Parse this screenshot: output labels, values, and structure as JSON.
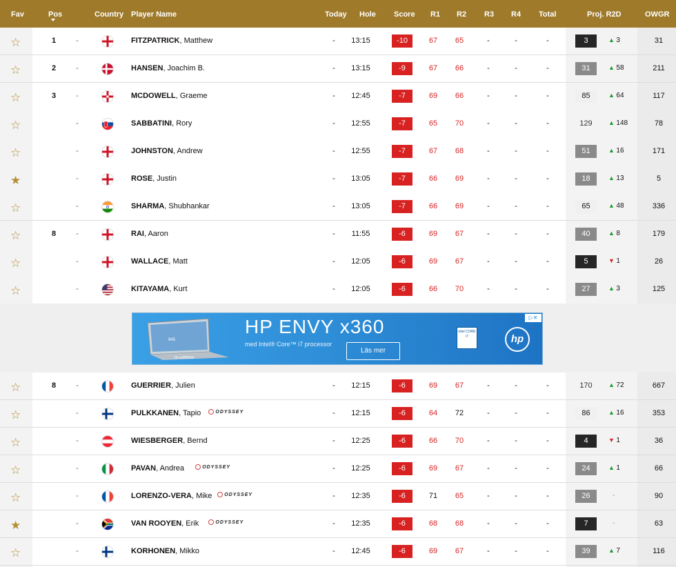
{
  "header": {
    "fav": "Fav",
    "pos": "Pos",
    "country": "Country",
    "player": "Player Name",
    "today": "Today",
    "hole": "Hole",
    "score": "Score",
    "r1": "R1",
    "r2": "R2",
    "r3": "R3",
    "r4": "R4",
    "total": "Total",
    "proj": "Proj. R2D",
    "owgr": "OWGR"
  },
  "colors": {
    "gold": "#9e7a2a",
    "score_red": "#d82222",
    "up_green": "#1a9a2e"
  },
  "rows_top": [
    {
      "fav": false,
      "pos": "1",
      "flag": "england",
      "last": "FITZPATRICK",
      "first": ", Matthew",
      "sponsor": "",
      "today": "-",
      "hole": "13:15",
      "score": "-10",
      "r1": "67",
      "r2": "65",
      "r3": "-",
      "r4": "-",
      "total": "-",
      "proj": "3",
      "proj_style": "dark",
      "move_dir": "up",
      "move": "3",
      "owgr": "31",
      "sep": true
    },
    {
      "fav": false,
      "pos": "2",
      "flag": "denmark",
      "last": "HANSEN",
      "first": ", Joachim B.",
      "sponsor": "",
      "today": "-",
      "hole": "13:15",
      "score": "-9",
      "r1": "67",
      "r2": "66",
      "r3": "-",
      "r4": "-",
      "total": "-",
      "proj": "31",
      "proj_style": "grey",
      "move_dir": "up",
      "move": "58",
      "owgr": "211",
      "sep": true
    },
    {
      "fav": false,
      "pos": "3",
      "flag": "northern-ireland",
      "last": "MCDOWELL",
      "first": ", Graeme",
      "sponsor": "",
      "today": "-",
      "hole": "12:45",
      "score": "-7",
      "r1": "69",
      "r2": "66",
      "r3": "-",
      "r4": "-",
      "total": "-",
      "proj": "85",
      "proj_style": "light",
      "move_dir": "up",
      "move": "64",
      "owgr": "117",
      "sep": false
    },
    {
      "fav": false,
      "pos": "",
      "flag": "slovakia",
      "last": "SABBATINI",
      "first": ", Rory",
      "sponsor": "",
      "today": "-",
      "hole": "12:55",
      "score": "-7",
      "r1": "65",
      "r2": "70",
      "r3": "-",
      "r4": "-",
      "total": "-",
      "proj": "129",
      "proj_style": "plain",
      "move_dir": "up",
      "move": "148",
      "owgr": "78",
      "sep": false
    },
    {
      "fav": false,
      "pos": "",
      "flag": "england",
      "last": "JOHNSTON",
      "first": ", Andrew",
      "sponsor": "",
      "today": "-",
      "hole": "12:55",
      "score": "-7",
      "r1": "67",
      "r2": "68",
      "r3": "-",
      "r4": "-",
      "total": "-",
      "proj": "51",
      "proj_style": "grey",
      "move_dir": "up",
      "move": "16",
      "owgr": "171",
      "sep": false
    },
    {
      "fav": true,
      "pos": "",
      "flag": "england",
      "last": "ROSE",
      "first": ", Justin",
      "sponsor": "",
      "today": "-",
      "hole": "13:05",
      "score": "-7",
      "r1": "66",
      "r2": "69",
      "r3": "-",
      "r4": "-",
      "total": "-",
      "proj": "18",
      "proj_style": "grey",
      "move_dir": "up",
      "move": "13",
      "owgr": "5",
      "sep": false
    },
    {
      "fav": false,
      "pos": "",
      "flag": "india",
      "last": "SHARMA",
      "first": ", Shubhankar",
      "sponsor": "",
      "today": "-",
      "hole": "13:05",
      "score": "-7",
      "r1": "66",
      "r2": "69",
      "r3": "-",
      "r4": "-",
      "total": "-",
      "proj": "65",
      "proj_style": "light",
      "move_dir": "up",
      "move": "48",
      "owgr": "336",
      "sep": true
    },
    {
      "fav": false,
      "pos": "8",
      "flag": "england",
      "last": "RAI",
      "first": ", Aaron",
      "sponsor": "",
      "today": "-",
      "hole": "11:55",
      "score": "-6",
      "r1": "69",
      "r2": "67",
      "r3": "-",
      "r4": "-",
      "total": "-",
      "proj": "40",
      "proj_style": "grey",
      "move_dir": "up",
      "move": "8",
      "owgr": "179",
      "sep": false
    },
    {
      "fav": false,
      "pos": "",
      "flag": "england",
      "last": "WALLACE",
      "first": ", Matt",
      "sponsor": "",
      "today": "-",
      "hole": "12:05",
      "score": "-6",
      "r1": "69",
      "r2": "67",
      "r3": "-",
      "r4": "-",
      "total": "-",
      "proj": "5",
      "proj_style": "dark",
      "move_dir": "down",
      "move": "1",
      "owgr": "26",
      "sep": false
    },
    {
      "fav": false,
      "pos": "",
      "flag": "usa",
      "last": "KITAYAMA",
      "first": ", Kurt",
      "sponsor": "",
      "today": "-",
      "hole": "12:05",
      "score": "-6",
      "r1": "66",
      "r2": "70",
      "r3": "-",
      "r4": "-",
      "total": "-",
      "proj": "27",
      "proj_style": "grey",
      "move_dir": "up",
      "move": "3",
      "owgr": "125",
      "sep": false
    }
  ],
  "ad": {
    "title": "HP ENVY x360",
    "subtitle": "med Intel® Core™ i7 processor",
    "button": "Läs mer",
    "intel_text": "intel CORE i7",
    "brand": "hp",
    "model": "15-cn0850nd",
    "screen_text": "945"
  },
  "rows_bottom": [
    {
      "fav": false,
      "pos": "8",
      "flag": "france",
      "last": "GUERRIER",
      "first": ", Julien",
      "sponsor": "",
      "today": "-",
      "hole": "12:15",
      "score": "-6",
      "r1": "69",
      "r2": "67",
      "r3": "-",
      "r4": "-",
      "total": "-",
      "proj": "170",
      "proj_style": "plain",
      "move_dir": "up",
      "move": "72",
      "owgr": "667"
    },
    {
      "fav": false,
      "pos": "",
      "flag": "finland",
      "last": "PULKKANEN",
      "first": ", Tapio",
      "sponsor": "ODYSSEY",
      "today": "-",
      "hole": "12:15",
      "score": "-6",
      "r1": "64",
      "r2": "72",
      "r3": "-",
      "r4": "-",
      "total": "-",
      "proj": "86",
      "proj_style": "light",
      "move_dir": "up",
      "move": "16",
      "owgr": "353"
    },
    {
      "fav": false,
      "pos": "",
      "flag": "austria",
      "last": "WIESBERGER",
      "first": ", Bernd",
      "sponsor": "",
      "today": "-",
      "hole": "12:25",
      "score": "-6",
      "r1": "66",
      "r2": "70",
      "r3": "-",
      "r4": "-",
      "total": "-",
      "proj": "4",
      "proj_style": "dark",
      "move_dir": "down",
      "move": "1",
      "owgr": "36"
    },
    {
      "fav": false,
      "pos": "",
      "flag": "italy",
      "last": "PAVAN",
      "first": ", Andrea",
      "sponsor": "ODYSSEY",
      "today": "-",
      "hole": "12:25",
      "score": "-6",
      "r1": "69",
      "r2": "67",
      "r3": "-",
      "r4": "-",
      "total": "-",
      "proj": "24",
      "proj_style": "grey",
      "move_dir": "up",
      "move": "1",
      "owgr": "66"
    },
    {
      "fav": false,
      "pos": "",
      "flag": "france",
      "last": "LORENZO-VERA",
      "first": ", Mike",
      "sponsor": "ODYSSEY",
      "today": "-",
      "hole": "12:35",
      "score": "-6",
      "r1": "71",
      "r2": "65",
      "r3": "-",
      "r4": "-",
      "total": "-",
      "proj": "26",
      "proj_style": "grey",
      "move_dir": "none",
      "move": "-",
      "owgr": "90"
    },
    {
      "fav": true,
      "pos": "",
      "flag": "south-africa",
      "last": "VAN ROOYEN",
      "first": ", Erik",
      "sponsor": "ODYSSEY",
      "today": "-",
      "hole": "12:35",
      "score": "-6",
      "r1": "68",
      "r2": "68",
      "r3": "-",
      "r4": "-",
      "total": "-",
      "proj": "7",
      "proj_style": "dark",
      "move_dir": "none",
      "move": "-",
      "owgr": "63"
    },
    {
      "fav": false,
      "pos": "",
      "flag": "finland",
      "last": "KORHONEN",
      "first": ", Mikko",
      "sponsor": "",
      "today": "-",
      "hole": "12:45",
      "score": "-6",
      "r1": "69",
      "r2": "67",
      "r3": "-",
      "r4": "-",
      "total": "-",
      "proj": "39",
      "proj_style": "grey",
      "move_dir": "up",
      "move": "7",
      "owgr": "116"
    }
  ]
}
